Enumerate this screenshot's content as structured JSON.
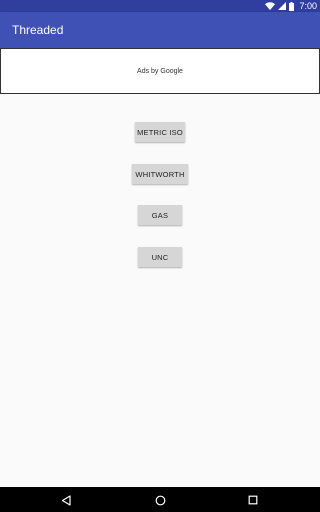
{
  "status_bar": {
    "time": "7:00",
    "icons": [
      "wifi-icon",
      "signal-icon",
      "battery-icon"
    ]
  },
  "app_bar": {
    "title": "Threaded"
  },
  "ad_banner": {
    "label": "Ads by Google"
  },
  "buttons": [
    {
      "label": "METRIC ISO"
    },
    {
      "label": "WHITWORTH"
    },
    {
      "label": "GAS"
    },
    {
      "label": "UNC"
    }
  ],
  "nav_bar": {
    "icons": [
      "back-icon",
      "home-icon",
      "recents-icon"
    ]
  },
  "colors": {
    "primary": "#3f51b5",
    "primary_dark": "#303f9f",
    "background": "#fafafa",
    "button": "#d6d6d6"
  }
}
